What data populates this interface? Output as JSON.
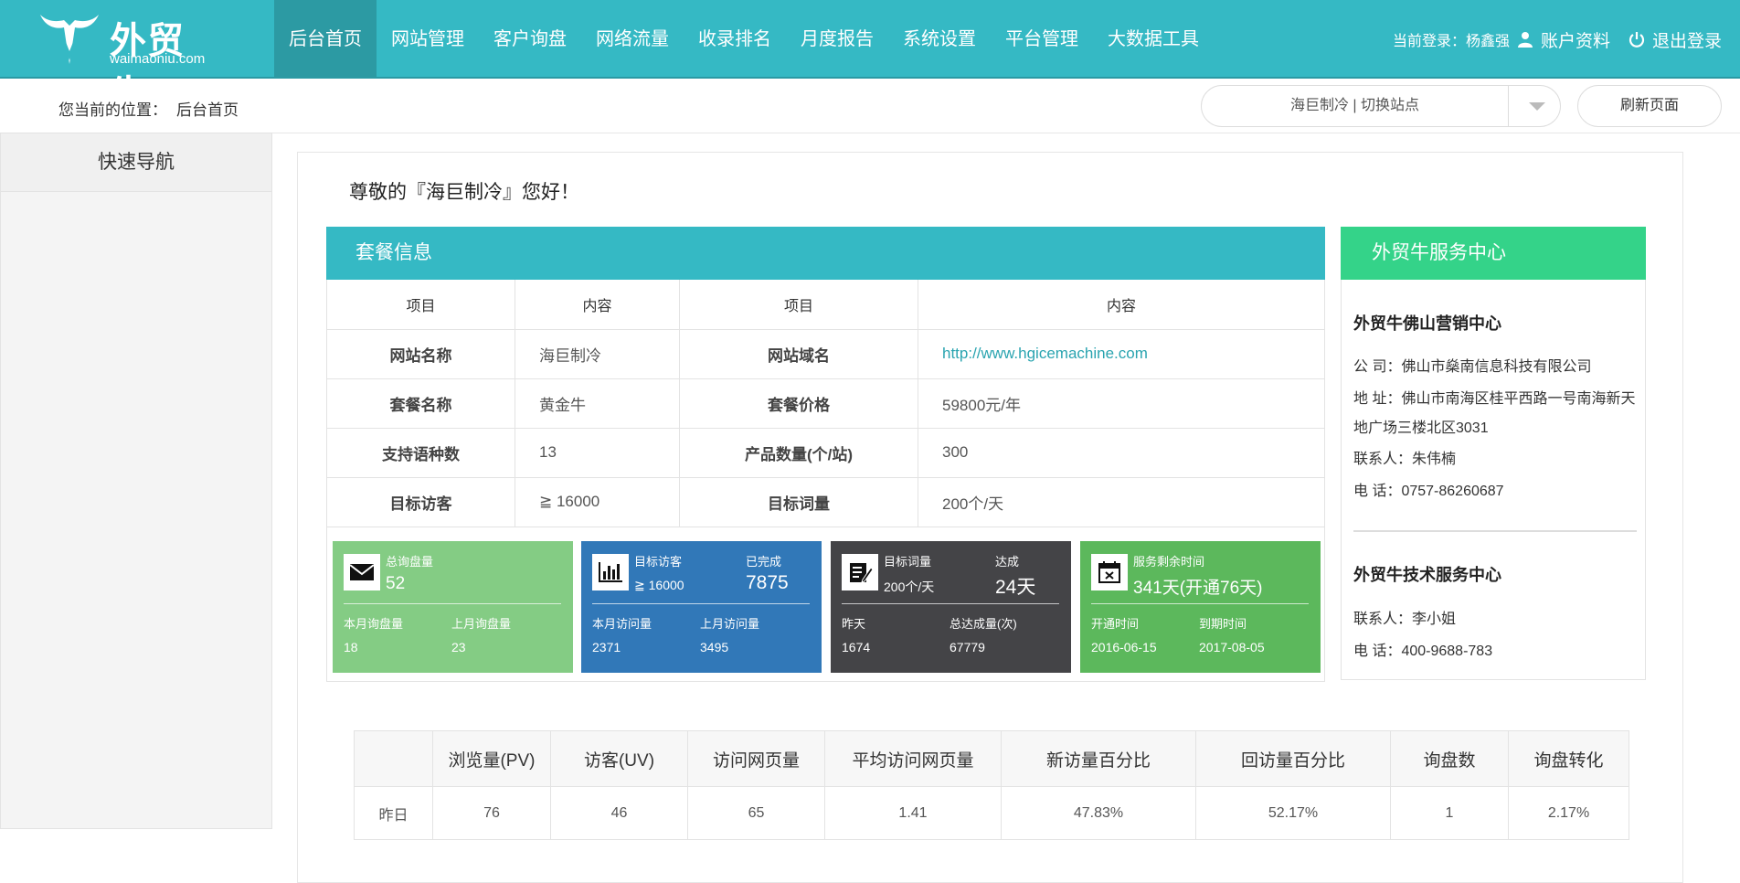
{
  "brand": {
    "name": "外贸牛",
    "sub": "waimaoniu.com"
  },
  "nav": [
    "后台首页",
    "网站管理",
    "客户询盘",
    "网络流量",
    "收录排名",
    "月度报告",
    "系统设置",
    "平台管理",
    "大数据工具"
  ],
  "user": {
    "login": "当前登录：杨鑫强",
    "account": "账户资料",
    "logout": "退出登录"
  },
  "breadcrumb": {
    "prefix": "您当前的位置：",
    "current": "后台首页"
  },
  "site_switch": "海巨制冷 | 切换站点",
  "refresh": "刷新页面",
  "sidebar": {
    "title": "快速导航"
  },
  "greeting": "尊敬的『海巨制冷』您好！",
  "package": {
    "title": "套餐信息",
    "header": [
      "项目",
      "内容",
      "项目",
      "内容"
    ],
    "rows": [
      [
        "网站名称",
        "海巨制冷",
        "网站域名",
        "http://www.hgicemachine.com"
      ],
      [
        "套餐名称",
        "黄金牛",
        "套餐价格",
        "59800元/年"
      ],
      [
        "支持语种数",
        "13",
        "产品数量(个/站)",
        "300"
      ],
      [
        "目标访客",
        "≧ 16000",
        "目标词量",
        "200个/天"
      ]
    ]
  },
  "cards": [
    {
      "color": "#84cc84",
      "icon": "envelope-icon",
      "t1": "总询盘量",
      "n1": "52",
      "t2": "",
      "n2": "",
      "b1": "本月询盘量",
      "bv1": "18",
      "b2": "上月询盘量",
      "bv2": "23"
    },
    {
      "color": "#3178b8",
      "icon": "bar-chart-icon",
      "t1": "目标访客",
      "n1": "≧ 16000",
      "t2": "已完成",
      "n2": "7875",
      "b1": "本月访问量",
      "bv1": "2371",
      "b2": "上月访问量",
      "bv2": "3495"
    },
    {
      "color": "#444447",
      "icon": "edit-icon",
      "t1": "目标词量",
      "n1": "200个/天",
      "t2": "达成",
      "n2": "24天",
      "b1": "昨天",
      "bv1": "1674",
      "b2": "总达成量(次)",
      "bv2": "67779"
    },
    {
      "color": "#5cb85c",
      "icon": "calendar-icon",
      "t1": "服务剩余时间",
      "n1": "341天(开通76天)",
      "t2": "",
      "n2": "",
      "b1": "开通时间",
      "bv1": "2016-06-15",
      "b2": "到期时间",
      "bv2": "2017-08-05"
    }
  ],
  "service": {
    "title": "外贸牛服务中心",
    "center1": "外贸牛佛山营销中心",
    "lines1": [
      "公 司：佛山市燊南信息科技有限公司",
      "地 址：佛山市南海区桂平西路一号南海新天地广场三楼北区3031",
      "联系人：朱伟楠",
      "电 话：0757-86260687"
    ],
    "center2": "外贸牛技术服务中心",
    "lines2": [
      "联系人：李小姐",
      "电 话：400-9688-783"
    ]
  },
  "stats": {
    "header": [
      "",
      "浏览量(PV)",
      "访客(UV)",
      "访问网页量",
      "平均访问网页量",
      "新访量百分比",
      "回访量百分比",
      "询盘数",
      "询盘转化"
    ],
    "rows": [
      [
        "昨日",
        "76",
        "46",
        "65",
        "1.41",
        "47.83%",
        "52.17%",
        "1",
        "2.17%"
      ]
    ]
  }
}
